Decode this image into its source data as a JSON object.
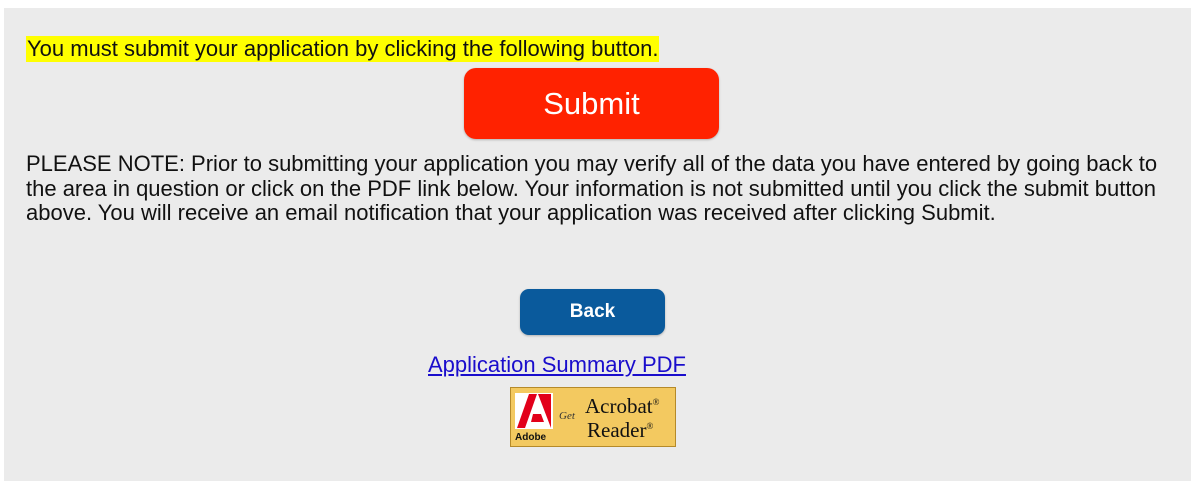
{
  "instruction_text": "You must submit your application by clicking the following button.",
  "submit_button": {
    "label": "Submit"
  },
  "note_text": "PLEASE NOTE: Prior to submitting your application you may verify all of the data you have entered by going back to the area in question or click on the PDF link below. Your information is not submitted until you click the submit button above. You will receive an email notification that your application was received after clicking Submit.",
  "back_button": {
    "label": "Back"
  },
  "pdf_link": {
    "label": "Application Summary PDF"
  },
  "acrobat_badge": {
    "brand": "Adobe",
    "get": "Get",
    "product_line1": "Acrobat",
    "product_line2": "Reader",
    "registered_mark": "®"
  },
  "colors": {
    "panel_background": "#ebebeb",
    "highlight": "#ffff00",
    "submit": "#ff2200",
    "back": "#0a5a9c",
    "link": "#1a0dcc",
    "badge": "#f3c960"
  }
}
